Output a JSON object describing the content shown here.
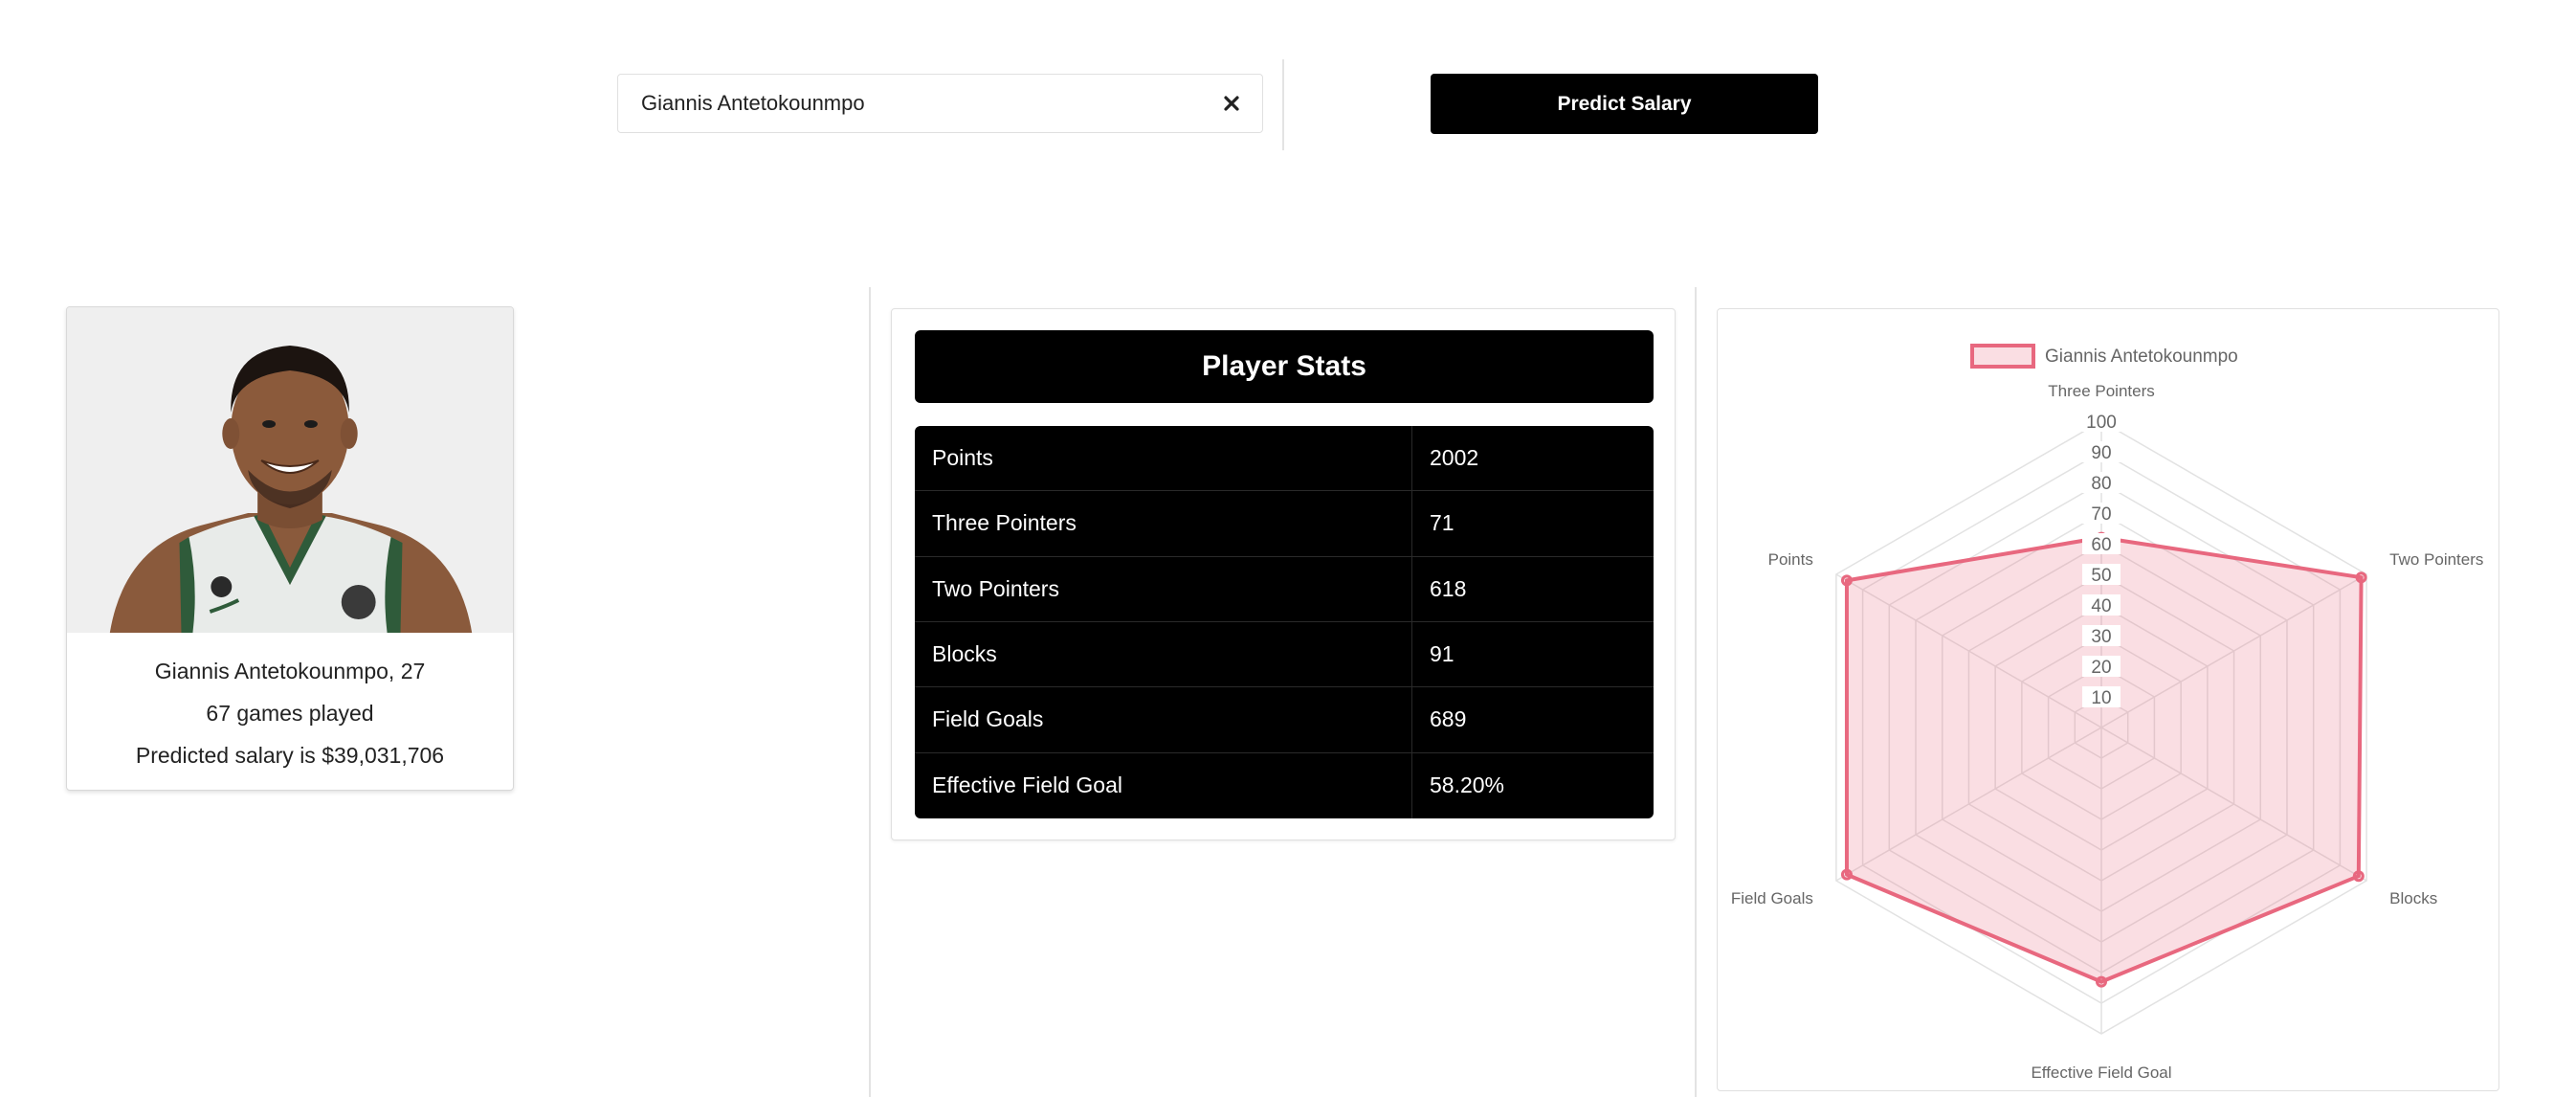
{
  "search": {
    "value": "Giannis Antetokounmpo",
    "clear_icon": "close-icon"
  },
  "predict_button": {
    "label": "Predict Salary"
  },
  "player": {
    "name_age": "Giannis Antetokounmpo, 27",
    "games": "67 games played",
    "salary": "Predicted salary is $39,031,706"
  },
  "stats": {
    "title": "Player Stats",
    "rows": [
      {
        "label": "Points",
        "value": "2002"
      },
      {
        "label": "Three Pointers",
        "value": "71"
      },
      {
        "label": "Two Pointers",
        "value": "618"
      },
      {
        "label": "Blocks",
        "value": "91"
      },
      {
        "label": "Field Goals",
        "value": "689"
      },
      {
        "label": "Effective Field Goal",
        "value": "58.20%"
      }
    ]
  },
  "chart_data": {
    "type": "radar",
    "labels": [
      "Three Pointers",
      "Two Pointers",
      "Blocks",
      "Effective Field Goal",
      "Field Goals",
      "Points"
    ],
    "series": [
      {
        "name": "Giannis Antetokounmpo",
        "values": [
          62,
          98,
          97,
          83,
          96,
          96
        ],
        "color": "#e8687f",
        "fill": "rgba(232,104,127,0.22)"
      }
    ],
    "r_min": 0,
    "r_max": 100,
    "ticks": [
      10,
      20,
      30,
      40,
      50,
      60,
      70,
      80,
      90,
      100
    ],
    "legend": "top"
  }
}
